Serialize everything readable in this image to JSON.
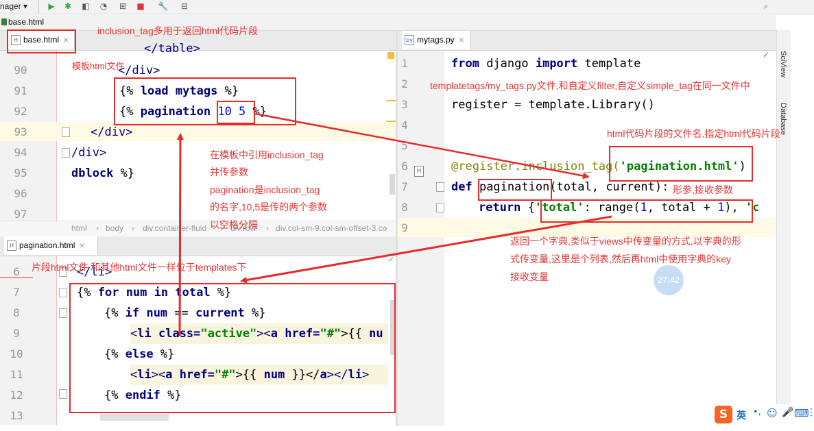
{
  "toolbar": {
    "config_label": "nager",
    "icons": [
      "run-icon",
      "debug-icon",
      "coverage-icon",
      "profile-icon",
      "concurrency-icon",
      "stop-icon",
      "wrench-icon",
      "structure-icon",
      "search-icon"
    ]
  },
  "nav_crumb": "base.html",
  "tabs": {
    "left_top": "base.html",
    "left_bottom": "pagination.html",
    "right": "mytags.py"
  },
  "base_editor": {
    "line_numbers": [
      "90",
      "91",
      "92",
      "93",
      "94",
      "95",
      "96",
      "97"
    ],
    "lines": {
      "l89": "</table>",
      "l90": "</div>",
      "l91_a": "{% ",
      "l91_b": "load",
      "l91_c": " ",
      "l91_d": "mytags",
      "l91_e": " %}",
      "l92_a": "{% ",
      "l92_b": "pagination",
      "l92_c": " ",
      "l92_d": "10 5",
      "l92_e": " %}",
      "l93": "</div>",
      "l94": "/div>",
      "l95_a": "dblock",
      "l95_b": " %}"
    },
    "breadcrumb": [
      "html",
      "body",
      "div.container-fluid",
      "div.row",
      "div.col-sm-9.col-sm-offset-3.co"
    ]
  },
  "pagination_editor": {
    "line_numbers": [
      "6",
      "7",
      "8",
      "9",
      "10",
      "11",
      "12",
      "13"
    ],
    "lines": {
      "l6": "</li>",
      "l7_a": "{% ",
      "l7_b": "for",
      "l7_c": " ",
      "l7_d": "num",
      "l7_e": " ",
      "l7_f": "in",
      "l7_g": " ",
      "l7_h": "total",
      "l7_i": " %}",
      "l8_a": "{% ",
      "l8_b": "if",
      "l8_c": " ",
      "l8_d": "num",
      "l8_e": " == ",
      "l8_f": "current",
      "l8_g": " %}",
      "l9_a": "<",
      "l9_b": "li",
      "l9_c": " ",
      "l9_d": "class=",
      "l9_e": "\"active\"",
      "l9_f": "><",
      "l9_g": "a",
      "l9_h": " ",
      "l9_i": "href=",
      "l9_j": "\"#\"",
      "l9_k": ">{{ ",
      "l9_l": "nu",
      "l10_a": "{% ",
      "l10_b": "else",
      "l10_c": " %}",
      "l11_a": "<",
      "l11_b": "li",
      "l11_c": "><",
      "l11_d": "a",
      "l11_e": " ",
      "l11_f": "href=",
      "l11_g": "\"#\"",
      "l11_h": ">{{ ",
      "l11_i": "num",
      "l11_j": " }}</",
      "l11_k": "a",
      "l11_l": "></",
      "l11_m": "li",
      "l11_n": ">",
      "l12_a": "{% ",
      "l12_b": "endif",
      "l12_c": " %}"
    }
  },
  "mytags_editor": {
    "line_numbers": [
      "1",
      "2",
      "3",
      "4",
      "5",
      "6",
      "7",
      "8",
      "9"
    ],
    "lines": {
      "l1_a": "from",
      "l1_b": " django ",
      "l1_c": "import",
      "l1_d": " template",
      "l3": "register = template.Library()",
      "l6_a": "@register.inclusion_tag(",
      "l6_b": "'pagination.html'",
      "l6_c": ")",
      "l7_a": "def",
      "l7_b": " pagination",
      "l7_c": "(total, current):",
      "l8_a": "return",
      "l8_b": " {",
      "l8_c": "'total'",
      "l8_d": ": range(",
      "l8_e": "1",
      "l8_f": ", total + ",
      "l8_g": "1",
      "l8_h": "), ",
      "l8_i": "'c"
    }
  },
  "sidebar": {
    "sciview": "SciView",
    "database": "Database"
  },
  "annotations": {
    "a1": "inclusion_tag多用于返回html代码片段",
    "a2": "模板html文件",
    "a3": "templatetags/my_tags.py文件,和自定义filter,自定义simple_tag在同一文件中",
    "a4": "html代码片段的文件名,指定html代码片段",
    "a5": "在模板中引用inclusion_tag",
    "a6": "并传参数",
    "a7": "pagination是inclusion_tag",
    "a8": "的名字,10,5是传的两个参数",
    "a9": "以空格分隔",
    "a10": "形参,接收参数",
    "a11": "返回一个字典,类似于views中传变量的方式,以字典的形",
    "a12": "式传变量,这里是个列表,然后再html中使用字典的key",
    "a13": "接收变量",
    "a14": "片段html文件 和其他html文件一样位于templates下"
  },
  "clock": "27:42",
  "ime": {
    "logo": "S",
    "lang": "英"
  },
  "colors": {
    "annotation": "#e53535",
    "keyword": "#000080",
    "string": "#008000",
    "number": "#0000ff"
  }
}
